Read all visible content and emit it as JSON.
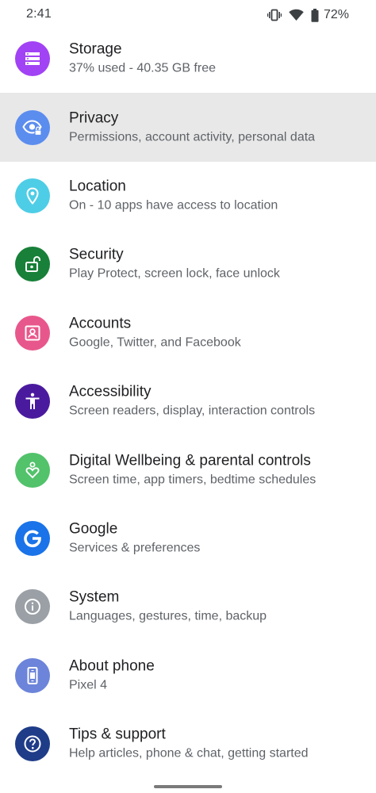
{
  "status_bar": {
    "time": "2:41",
    "battery_percent": "72%",
    "icons": [
      "vibrate-icon",
      "wifi-icon",
      "battery-icon"
    ]
  },
  "settings": [
    {
      "id": "storage",
      "title": "Storage",
      "subtitle": "37% used - 40.35 GB free",
      "icon": "storage-icon",
      "color": "#a142f4"
    },
    {
      "id": "privacy",
      "title": "Privacy",
      "subtitle": "Permissions, account activity, personal data",
      "icon": "privacy-eye-icon",
      "color": "#5b8def",
      "highlighted": true
    },
    {
      "id": "location",
      "title": "Location",
      "subtitle": "On - 10 apps have access to location",
      "icon": "location-pin-icon",
      "color": "#4ecde6"
    },
    {
      "id": "security",
      "title": "Security",
      "subtitle": "Play Protect, screen lock, face unlock",
      "icon": "unlocked-padlock-icon",
      "color": "#188038"
    },
    {
      "id": "accounts",
      "title": "Accounts",
      "subtitle": "Google, Twitter, and Facebook",
      "icon": "account-box-icon",
      "color": "#e8578b"
    },
    {
      "id": "accessibility",
      "title": "Accessibility",
      "subtitle": "Screen readers, display, interaction controls",
      "icon": "accessibility-person-icon",
      "color": "#4a1a9e"
    },
    {
      "id": "digital-wellbeing",
      "title": "Digital Wellbeing & parental controls",
      "subtitle": "Screen time, app timers, bedtime schedules",
      "icon": "wellbeing-heart-icon",
      "color": "#52c26b"
    },
    {
      "id": "google",
      "title": "Google",
      "subtitle": "Services & preferences",
      "icon": "google-g-icon",
      "color": "#1a73e8"
    },
    {
      "id": "system",
      "title": "System",
      "subtitle": "Languages, gestures, time, backup",
      "icon": "info-icon",
      "color": "#9aa0a6"
    },
    {
      "id": "about-phone",
      "title": "About phone",
      "subtitle": "Pixel 4",
      "icon": "phone-device-icon",
      "color": "#6c84d9"
    },
    {
      "id": "tips-support",
      "title": "Tips & support",
      "subtitle": "Help articles, phone & chat, getting started",
      "icon": "help-question-icon",
      "color": "#1f3c88"
    }
  ]
}
